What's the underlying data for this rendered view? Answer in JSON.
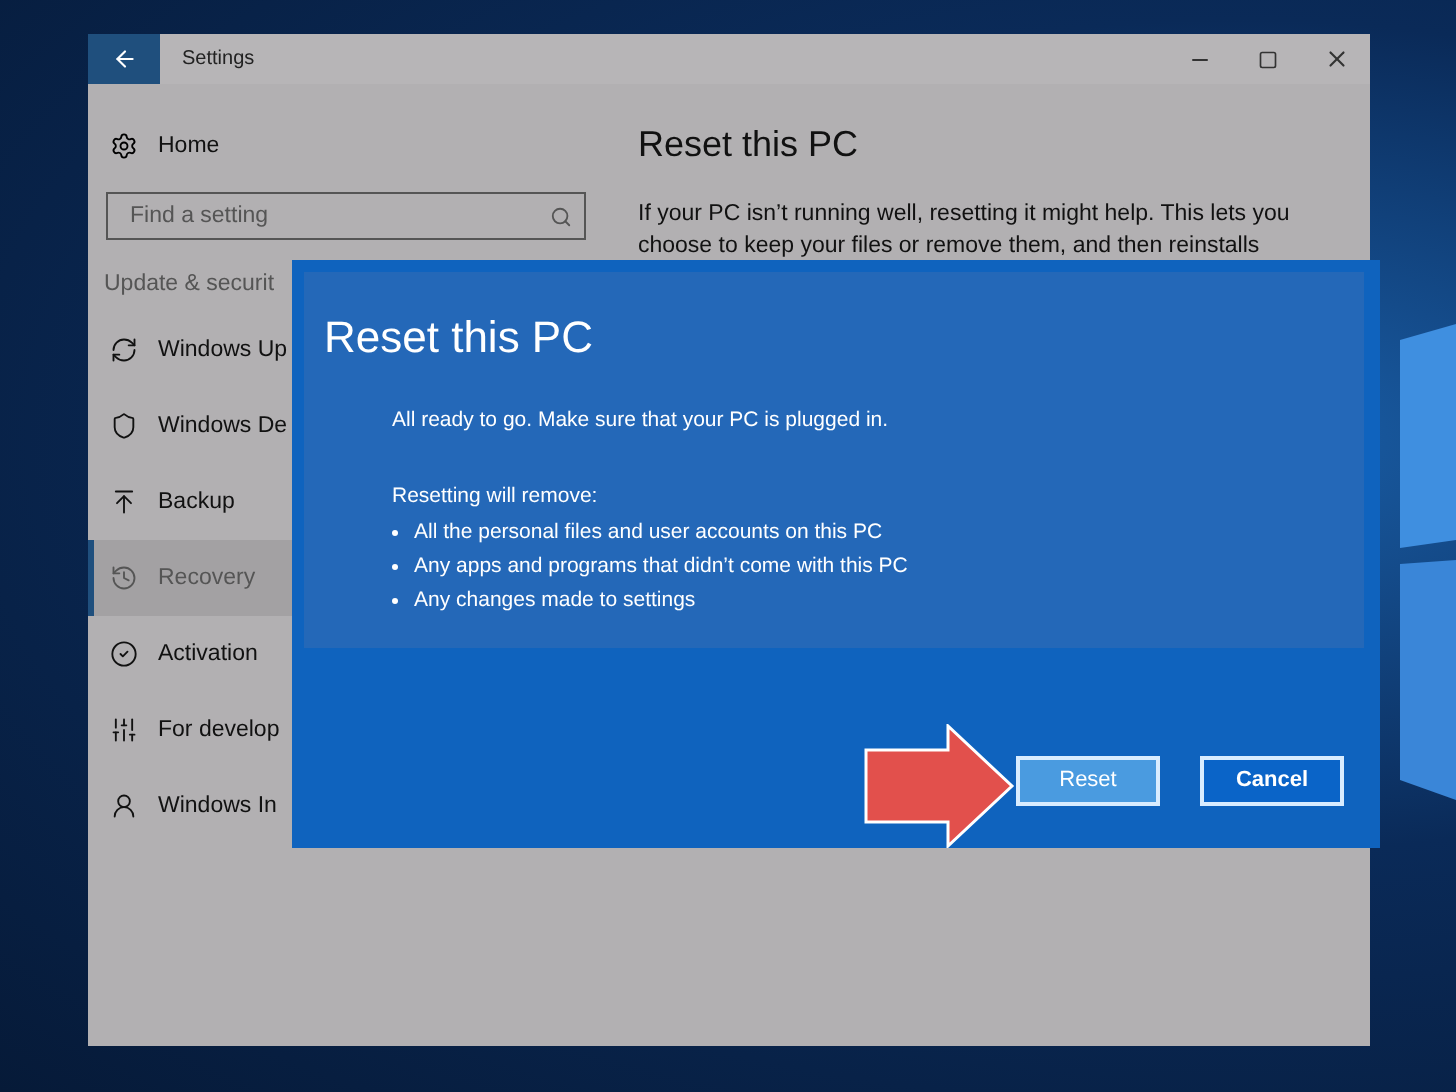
{
  "window": {
    "title": "Settings"
  },
  "sidebar": {
    "home": "Home",
    "search": {
      "placeholder": "Find a setting"
    },
    "section": "Update & securit",
    "items": [
      {
        "label": "Windows Up",
        "selected": false
      },
      {
        "label": "Windows De",
        "selected": false
      },
      {
        "label": "Backup",
        "selected": false
      },
      {
        "label": "Recovery",
        "selected": true
      },
      {
        "label": "Activation",
        "selected": false
      },
      {
        "label": "For develop",
        "selected": false
      },
      {
        "label": "Windows In",
        "selected": false
      }
    ]
  },
  "page": {
    "title": "Reset this PC",
    "text_lines": [
      "If your PC isn’t running well, resetting it might help. This lets you",
      "choose to keep your files or remove them, and then reinstalls"
    ]
  },
  "dialog": {
    "title": "Reset this PC",
    "message": "All ready to go. Make sure that your PC is plugged in.",
    "list_title": "Resetting will remove:",
    "list": [
      "All the personal files and user accounts on this PC",
      "Any apps and programs that didn’t come with this PC",
      "Any changes made to settings"
    ],
    "buttons": [
      {
        "label": "Reset",
        "kind": "primary"
      },
      {
        "label": "Cancel",
        "kind": "secondary"
      }
    ]
  }
}
